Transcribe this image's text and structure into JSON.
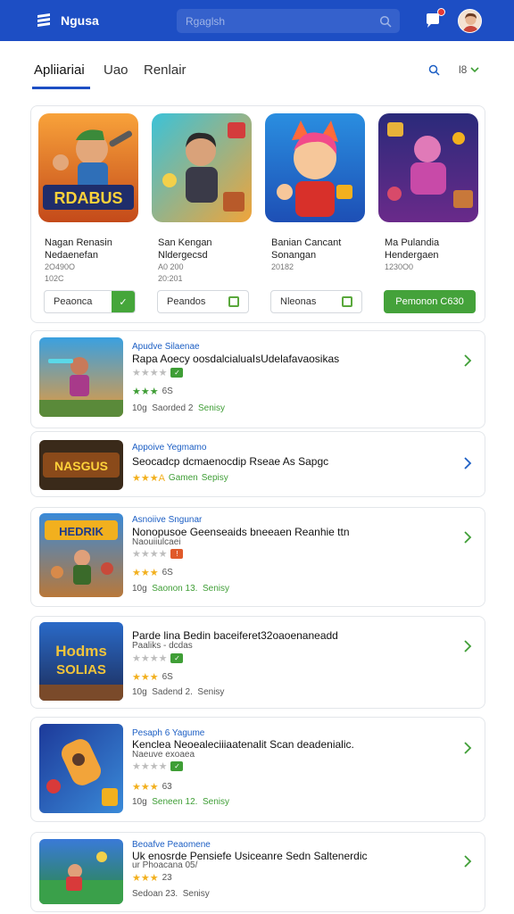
{
  "header": {
    "brand": "Ngusa",
    "search_placeholder": "Rgaglsh",
    "icons": [
      "menu-logo-icon",
      "search-icon",
      "notification-icon",
      "avatar"
    ],
    "accent": "#1d4ec4"
  },
  "tabs": {
    "items": [
      "Apliiariai",
      "Uao",
      "Renlair"
    ],
    "active": 0,
    "sort_label": "l8"
  },
  "featured": [
    {
      "title": "Nagan Renasin Nedaenefan",
      "sub1": "2O490O",
      "sub2": "102C",
      "button": "Peaonca",
      "button_style": "box"
    },
    {
      "title": "San Kengan Nldergecsd",
      "sub1": "A0 200",
      "sub2": "20:201",
      "button": "Peandos",
      "button_style": "check"
    },
    {
      "title": "Banian Cancant Sonangan",
      "sub1": "",
      "sub2": "20182",
      "button": "Nleonas",
      "button_style": "check"
    },
    {
      "title": "Ma Pulandia Hendergaen",
      "sub1": "1230O0",
      "sub2": "",
      "button": "Pemonon C630",
      "button_style": "green"
    }
  ],
  "list": [
    {
      "category": "Apudve Silaenae",
      "title": "Rapa Aoecy oosdalcialuaIsUdelafavaosikas",
      "desc": "",
      "stars_line1": "★★★★",
      "stars_line2": "★★★",
      "rating": "6S",
      "meta_prefix": "10g",
      "meta_a": "Saorded 2",
      "meta_b": "Senisy"
    },
    {
      "category": "Appoive Yegmamo",
      "title": "Seocadcp dcmaenocdip Rseae As Sapgc",
      "desc": "",
      "stars_line1": "",
      "stars_line2": "★★★A",
      "rating": "",
      "meta_prefix": "",
      "meta_a": "Gamen",
      "meta_b": "Sepisy"
    },
    {
      "category": "Asnoiive Sngunar",
      "title": "Nonopusoe Geenseaids bneeaen Reanhie ttn",
      "desc": "Naouiiulcaei",
      "stars_line1": "★★★★",
      "stars_line2": "★★★",
      "rating": "6S",
      "meta_prefix": "10g",
      "meta_a": "Saonon 13.",
      "meta_b": "Senisy"
    },
    {
      "category": "",
      "title": "Parde lina Bedin baceiferet32oaoenaneadd",
      "desc": "Paaliks - dcdas",
      "stars_line1": "★★★★",
      "stars_line2": "★★★",
      "rating": "6S",
      "meta_prefix": "10g",
      "meta_a": "Sadend 2.",
      "meta_b": "Senisy"
    },
    {
      "category": "Pesaph 6 Yagume",
      "title": "Kenclea Neoealeciiiaatenalit Scan deadenialic.",
      "desc": "Naeuve exoaea",
      "stars_line1": "★★★★",
      "stars_line2": "★★★",
      "rating": "63",
      "meta_prefix": "10g",
      "meta_a": "Seneen 12.",
      "meta_b": "Senisy"
    },
    {
      "category": "Beoafve Peaomene",
      "title": "Uk enosrde Pensiefe Usiceanre Sedn Saltenerdic",
      "desc": "ur Phoacana 05/",
      "stars_line1": "",
      "stars_line2": "★★★",
      "rating": "23",
      "meta_prefix": "",
      "meta_a": "Sedoan 23.",
      "meta_b": "Senisy"
    }
  ]
}
